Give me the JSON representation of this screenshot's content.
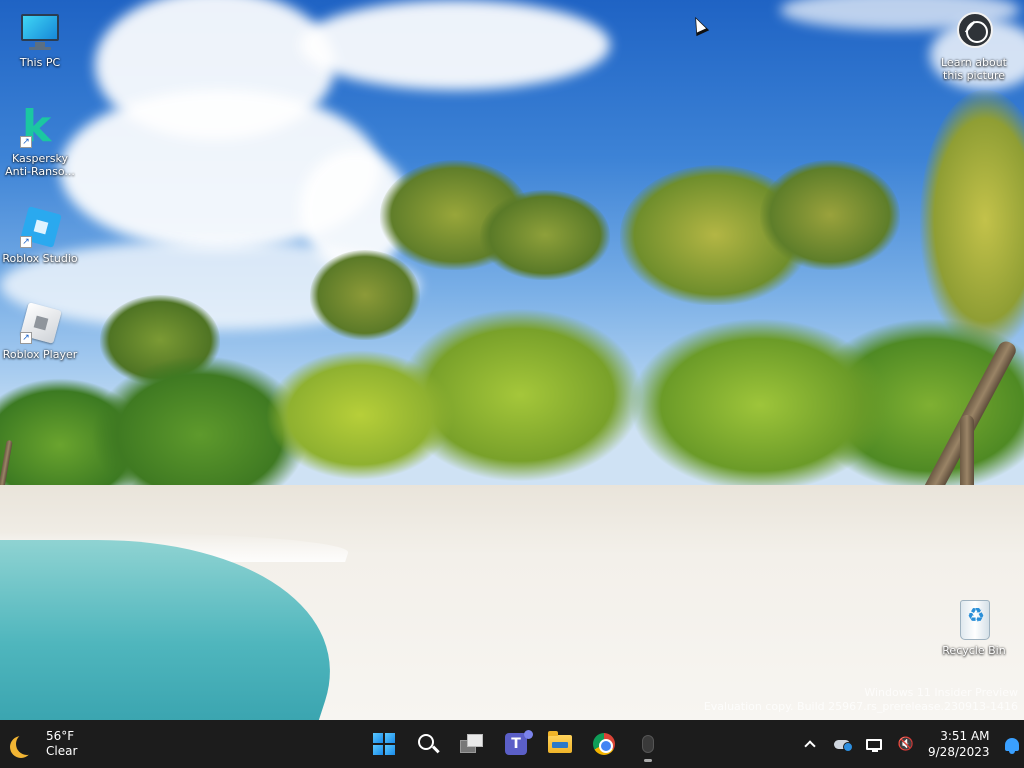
{
  "desktop": {
    "icons": [
      {
        "id": "this-pc",
        "label": "This PC"
      },
      {
        "id": "kaspersky",
        "label": "Kaspersky Anti-Ranso..."
      },
      {
        "id": "roblox-studio",
        "label": "Roblox Studio"
      },
      {
        "id": "roblox-player",
        "label": "Roblox Player"
      }
    ],
    "learn": {
      "label": "Learn about this picture"
    },
    "recycle_bin": {
      "label": "Recycle Bin"
    },
    "watermark": {
      "line1": "Windows 11 Insider Preview",
      "line2": "Evaluation copy. Build 25967.rs_prerelease.230913-1416"
    }
  },
  "taskbar": {
    "weather": {
      "temp": "56°F",
      "condition": "Clear",
      "icon": "moon-icon"
    },
    "apps": [
      {
        "name": "start",
        "icon": "windows-logo-icon"
      },
      {
        "name": "search",
        "icon": "search-icon"
      },
      {
        "name": "task-view",
        "icon": "task-view-icon"
      },
      {
        "name": "teams",
        "icon": "teams-icon",
        "glyph": "T"
      },
      {
        "name": "file-explorer",
        "icon": "folder-icon"
      },
      {
        "name": "chrome",
        "icon": "chrome-icon"
      },
      {
        "name": "mouse-app",
        "icon": "mouse-icon"
      }
    ],
    "tray": {
      "time": "3:51 AM",
      "date": "9/28/2023",
      "volume_glyph": "🔇"
    }
  },
  "colors": {
    "taskbar_bg": "#1c1c1c",
    "start_accent": "#1a8bea",
    "notification_bell": "#3aa0ff"
  }
}
